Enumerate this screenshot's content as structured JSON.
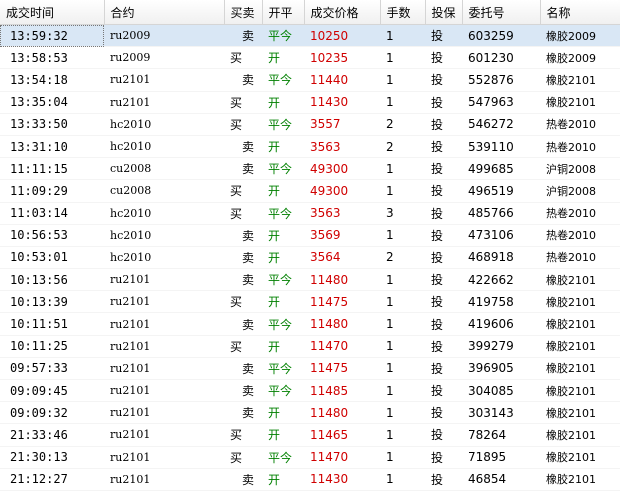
{
  "columns": [
    "成交时间",
    "合约",
    "买卖",
    "开平",
    "成交价格",
    "手数",
    "投保",
    "委托号",
    "名称"
  ],
  "rows": [
    {
      "time": "13:59:32",
      "contract": "ru2009",
      "side": "卖",
      "oc": "平今",
      "price": "10250",
      "qty": "1",
      "hedge": "投",
      "order": "603259",
      "name": "橡胶2009",
      "selected": true
    },
    {
      "time": "13:58:53",
      "contract": "ru2009",
      "side": "买",
      "oc": "开",
      "price": "10235",
      "qty": "1",
      "hedge": "投",
      "order": "601230",
      "name": "橡胶2009"
    },
    {
      "time": "13:54:18",
      "contract": "ru2101",
      "side": "卖",
      "oc": "平今",
      "price": "11440",
      "qty": "1",
      "hedge": "投",
      "order": "552876",
      "name": "橡胶2101"
    },
    {
      "time": "13:35:04",
      "contract": "ru2101",
      "side": "买",
      "oc": "开",
      "price": "11430",
      "qty": "1",
      "hedge": "投",
      "order": "547963",
      "name": "橡胶2101"
    },
    {
      "time": "13:33:50",
      "contract": "hc2010",
      "side": "买",
      "oc": "平今",
      "price": "3557",
      "qty": "2",
      "hedge": "投",
      "order": "546272",
      "name": "热卷2010"
    },
    {
      "time": "13:31:10",
      "contract": "hc2010",
      "side": "卖",
      "oc": "开",
      "price": "3563",
      "qty": "2",
      "hedge": "投",
      "order": "539110",
      "name": "热卷2010"
    },
    {
      "time": "11:11:15",
      "contract": "cu2008",
      "side": "卖",
      "oc": "平今",
      "price": "49300",
      "qty": "1",
      "hedge": "投",
      "order": "499685",
      "name": "沪铜2008"
    },
    {
      "time": "11:09:29",
      "contract": "cu2008",
      "side": "买",
      "oc": "开",
      "price": "49300",
      "qty": "1",
      "hedge": "投",
      "order": "496519",
      "name": "沪铜2008"
    },
    {
      "time": "11:03:14",
      "contract": "hc2010",
      "side": "买",
      "oc": "平今",
      "price": "3563",
      "qty": "3",
      "hedge": "投",
      "order": "485766",
      "name": "热卷2010"
    },
    {
      "time": "10:56:53",
      "contract": "hc2010",
      "side": "卖",
      "oc": "开",
      "price": "3569",
      "qty": "1",
      "hedge": "投",
      "order": "473106",
      "name": "热卷2010"
    },
    {
      "time": "10:53:01",
      "contract": "hc2010",
      "side": "卖",
      "oc": "开",
      "price": "3564",
      "qty": "2",
      "hedge": "投",
      "order": "468918",
      "name": "热卷2010"
    },
    {
      "time": "10:13:56",
      "contract": "ru2101",
      "side": "卖",
      "oc": "平今",
      "price": "11480",
      "qty": "1",
      "hedge": "投",
      "order": "422662",
      "name": "橡胶2101"
    },
    {
      "time": "10:13:39",
      "contract": "ru2101",
      "side": "买",
      "oc": "开",
      "price": "11475",
      "qty": "1",
      "hedge": "投",
      "order": "419758",
      "name": "橡胶2101"
    },
    {
      "time": "10:11:51",
      "contract": "ru2101",
      "side": "卖",
      "oc": "平今",
      "price": "11480",
      "qty": "1",
      "hedge": "投",
      "order": "419606",
      "name": "橡胶2101"
    },
    {
      "time": "10:11:25",
      "contract": "ru2101",
      "side": "买",
      "oc": "开",
      "price": "11470",
      "qty": "1",
      "hedge": "投",
      "order": "399279",
      "name": "橡胶2101"
    },
    {
      "time": "09:57:33",
      "contract": "ru2101",
      "side": "卖",
      "oc": "平今",
      "price": "11475",
      "qty": "1",
      "hedge": "投",
      "order": "396905",
      "name": "橡胶2101"
    },
    {
      "time": "09:09:45",
      "contract": "ru2101",
      "side": "卖",
      "oc": "平今",
      "price": "11485",
      "qty": "1",
      "hedge": "投",
      "order": "304085",
      "name": "橡胶2101"
    },
    {
      "time": "09:09:32",
      "contract": "ru2101",
      "side": "卖",
      "oc": "开",
      "price": "11480",
      "qty": "1",
      "hedge": "投",
      "order": "303143",
      "name": "橡胶2101"
    },
    {
      "time": "21:33:46",
      "contract": "ru2101",
      "side": "买",
      "oc": "开",
      "price": "11465",
      "qty": "1",
      "hedge": "投",
      "order": "78264",
      "name": "橡胶2101"
    },
    {
      "time": "21:30:13",
      "contract": "ru2101",
      "side": "买",
      "oc": "平今",
      "price": "11470",
      "qty": "1",
      "hedge": "投",
      "order": "71895",
      "name": "橡胶2101"
    },
    {
      "time": "21:12:27",
      "contract": "ru2101",
      "side": "卖",
      "oc": "开",
      "price": "11430",
      "qty": "1",
      "hedge": "投",
      "order": "46854",
      "name": "橡胶2101"
    }
  ]
}
